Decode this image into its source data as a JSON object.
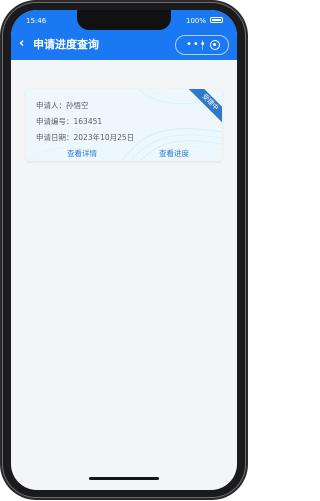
{
  "status_bar": {
    "time": "15:46",
    "battery": "100%"
  },
  "navbar": {
    "back_icon": "‹",
    "title": "申请进度查询",
    "more_icon": "•••"
  },
  "card": {
    "applicant_label": "申请人：",
    "applicant_value": "孙悟空",
    "number_label": "申请编号：",
    "number_value": "163451",
    "date_label": "申请日期：",
    "date_value": "2023年10月25日",
    "detail_link": "查看详情",
    "progress_link": "查看进度",
    "status_badge": "受理中"
  },
  "colors": {
    "primary": "#1a78f2",
    "link": "#2776d8",
    "badge": "#2f79c8",
    "background": "#f4f5f7"
  }
}
